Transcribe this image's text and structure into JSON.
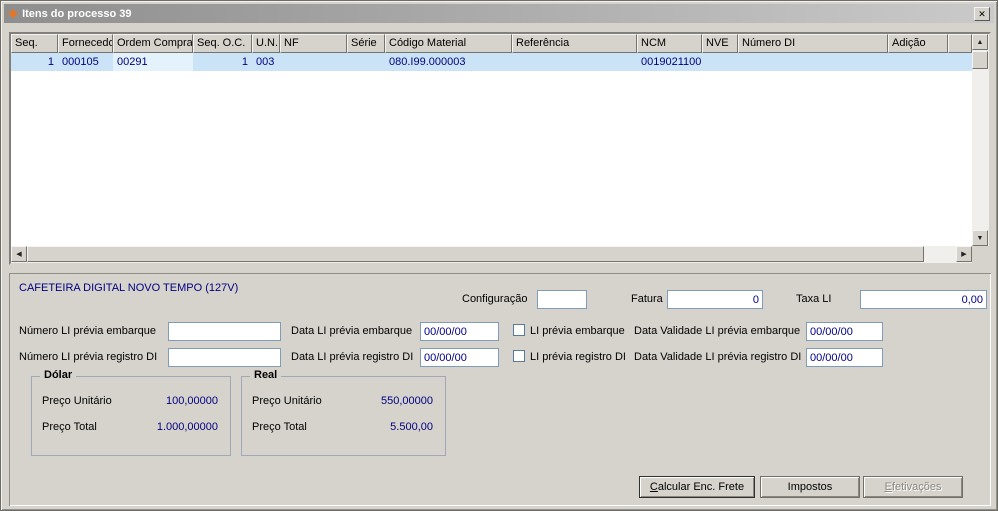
{
  "window": {
    "title": "Itens do processo 39"
  },
  "icons": {
    "app": "✱",
    "close": "✕",
    "up": "▲",
    "down": "▼",
    "left": "◀",
    "right": "▶"
  },
  "grid": {
    "columns": [
      "Seq.",
      "Fornecedor",
      "Ordem Compra",
      "Seq. O.C.",
      "U.N.",
      "NF",
      "Série",
      "Código Material",
      "Referência",
      "NCM",
      "NVE",
      "Número DI",
      "Adição"
    ],
    "rows": [
      [
        "1",
        "000105",
        "00291",
        "1",
        "003",
        "",
        "",
        "080.I99.000003",
        "",
        "0019021100",
        "",
        "",
        ""
      ]
    ],
    "focused_cell": {
      "row": 0,
      "col": 2
    }
  },
  "detail": {
    "product_name": "CAFETEIRA DIGITAL NOVO TEMPO (127V)",
    "fields": {
      "configuracao": {
        "label": "Configuração",
        "value": ""
      },
      "fatura": {
        "label": "Fatura",
        "value": "0"
      },
      "taxa_li": {
        "label": "Taxa LI",
        "value": "0,00"
      },
      "numero_li_embarque": {
        "label": "Número LI prévia embarque",
        "value": ""
      },
      "data_li_embarque": {
        "label": "Data LI prévia embarque",
        "value": "00/00/00"
      },
      "li_embarque_checkbox": {
        "label": "LI prévia embarque",
        "checked": false
      },
      "data_validade_li_embarque": {
        "label": "Data Validade LI prévia embarque",
        "value": "00/00/00"
      },
      "numero_li_registro": {
        "label": "Número LI prévia registro DI",
        "value": ""
      },
      "data_li_registro": {
        "label": "Data LI prévia registro DI",
        "value": "00/00/00"
      },
      "li_registro_checkbox": {
        "label": "LI prévia registro DI",
        "checked": false
      },
      "data_validade_li_registro": {
        "label": "Data Validade LI prévia registro DI",
        "value": "00/00/00"
      }
    },
    "dolar": {
      "title": "Dólar",
      "preco_unitario_label": "Preço Unitário",
      "preco_unitario": "100,00000",
      "preco_total_label": "Preço Total",
      "preco_total": "1.000,00000"
    },
    "real": {
      "title": "Real",
      "preco_unitario_label": "Preço Unitário",
      "preco_unitario": "550,00000",
      "preco_total_label": "Preço Total",
      "preco_total": "5.500,00"
    }
  },
  "buttons": {
    "calcular_frete": "Calcular Enc. Frete",
    "impostos": "Impostos",
    "efetivacoes": "Efetivações"
  }
}
